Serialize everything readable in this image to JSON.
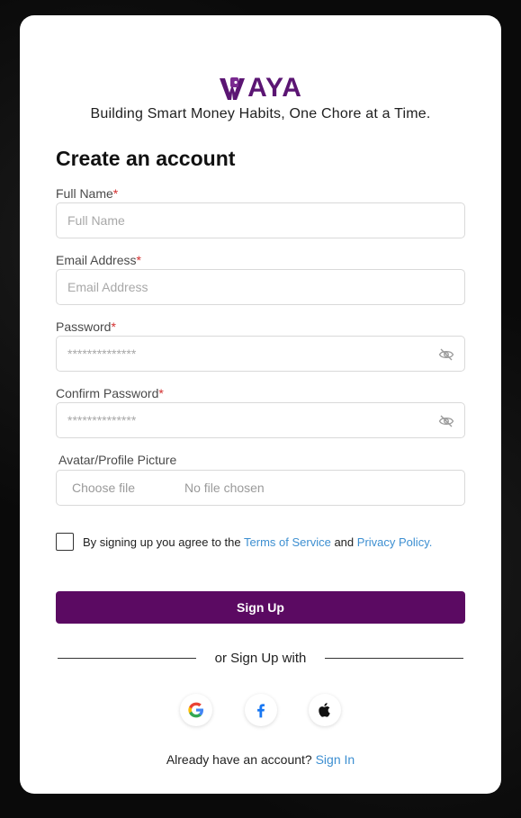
{
  "brand": {
    "logo_text": "AYA",
    "tagline": "Building Smart Money Habits, One Chore at a Time.",
    "brand_color": "#5b1573"
  },
  "form": {
    "heading": "Create an account",
    "full_name": {
      "label": "Full Name",
      "required_mark": "*",
      "placeholder": "Full Name",
      "value": ""
    },
    "email": {
      "label": "Email Address",
      "required_mark": "*",
      "placeholder": "Email Address",
      "value": ""
    },
    "password": {
      "label": "Password",
      "required_mark": "*",
      "placeholder": "**************",
      "icon": "eye-off-icon"
    },
    "confirm_password": {
      "label": "Confirm Password",
      "required_mark": "*",
      "placeholder": "**************",
      "icon": "eye-off-icon"
    },
    "avatar": {
      "label": "Avatar/Profile Picture",
      "button_label": "Choose file",
      "status": "No file chosen"
    },
    "terms": {
      "prefix": "By signing up you agree to the",
      "tos_link": "Terms of Service",
      "joiner": "and",
      "privacy_link": "Privacy Policy.",
      "checked": false
    },
    "submit_label": "Sign Up",
    "submit_color": "#5b0a62",
    "link_color": "#3d8fd1"
  },
  "social": {
    "divider_text": "or Sign Up with",
    "providers": [
      "google-icon",
      "facebook-icon",
      "apple-icon"
    ]
  },
  "footer": {
    "prompt": "Already have an account?",
    "signin_link": "Sign In"
  }
}
